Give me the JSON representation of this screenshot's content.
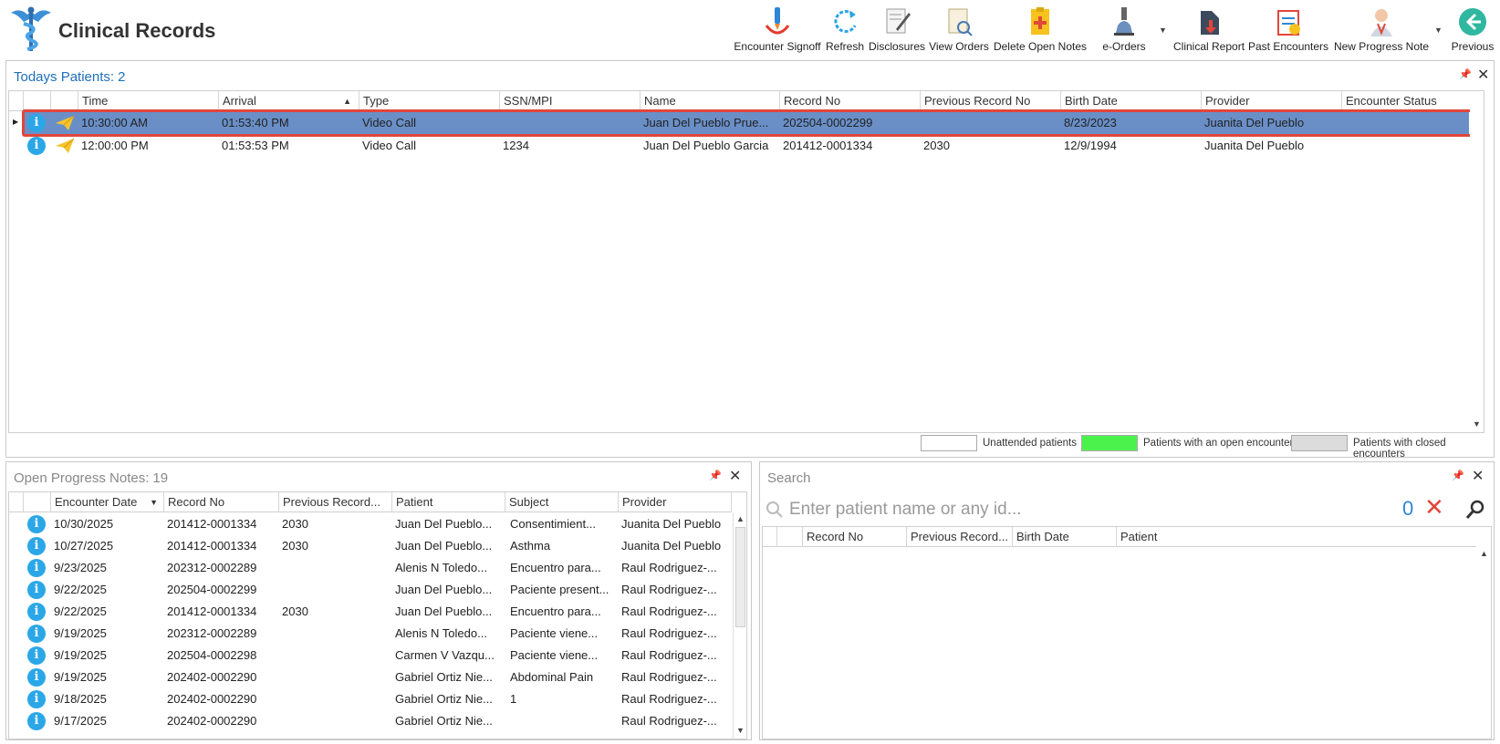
{
  "app": {
    "title": "Clinical Records"
  },
  "toolbar": [
    {
      "label": "Encounter Signoff",
      "icon": "encounter-signoff-icon"
    },
    {
      "label": "Refresh",
      "icon": "refresh-icon"
    },
    {
      "label": "Disclosures",
      "icon": "disclosures-icon"
    },
    {
      "label": "View Orders",
      "icon": "view-orders-icon"
    },
    {
      "label": "Delete Open Notes",
      "icon": "delete-open-notes-icon"
    },
    {
      "label": "e-Orders",
      "icon": "e-orders-icon"
    },
    {
      "label": "Clinical Report",
      "icon": "clinical-report-icon"
    },
    {
      "label": "Past Encounters",
      "icon": "past-encounters-icon"
    },
    {
      "label": "New Progress Note",
      "icon": "new-progress-note-icon"
    },
    {
      "label": "Previous",
      "icon": "previous-arrow-icon"
    }
  ],
  "todays": {
    "title": "Todays Patients:",
    "count": "2",
    "columns": [
      "Time",
      "Arrival",
      "Type",
      "SSN/MPI",
      "Name",
      "Record No",
      "Previous Record No",
      "Birth Date",
      "Provider",
      "Encounter Status"
    ],
    "rows": [
      [
        "10:30:00 AM",
        "01:53:40 PM",
        "Video Call",
        "",
        "Juan Del Pueblo Prue...",
        "202504-0002299",
        "",
        "8/23/2023",
        "Juanita Del Pueblo",
        ""
      ],
      [
        "12:00:00 PM",
        "01:53:53 PM",
        "Video Call",
        "1234",
        "Juan Del Pueblo Garcia",
        "201412-0001334",
        "2030",
        "12/9/1994",
        "Juanita Del Pueblo",
        ""
      ]
    ],
    "legend": {
      "unattended": "Unattended patients",
      "open": "Patients with an open encounter",
      "closed": "Patients with closed encounters",
      "open_color": "#4cf24c",
      "closed_color": "#dcdcdc"
    }
  },
  "notes": {
    "title": "Open Progress Notes:",
    "count": "19",
    "columns": [
      "Encounter Date",
      "Record No",
      "Previous Record...",
      "Patient",
      "Subject",
      "Provider"
    ],
    "rows": [
      [
        "10/30/2025",
        "201412-0001334",
        "2030",
        "Juan Del Pueblo...",
        "Consentimient...",
        "Juanita Del Pueblo"
      ],
      [
        "10/27/2025",
        "201412-0001334",
        "2030",
        "Juan Del Pueblo...",
        "Asthma",
        "Juanita Del Pueblo"
      ],
      [
        "9/23/2025",
        "202312-0002289",
        "",
        "Alenis N Toledo...",
        "Encuentro para...",
        "Raul Rodriguez-..."
      ],
      [
        "9/22/2025",
        "202504-0002299",
        "",
        "Juan Del Pueblo...",
        "Paciente present...",
        "Raul Rodriguez-..."
      ],
      [
        "9/22/2025",
        "201412-0001334",
        "2030",
        "Juan Del Pueblo...",
        "Encuentro para...",
        "Raul Rodriguez-..."
      ],
      [
        "9/19/2025",
        "202312-0002289",
        "",
        "Alenis N Toledo...",
        "Paciente viene...",
        "Raul Rodriguez-..."
      ],
      [
        "9/19/2025",
        "202504-0002298",
        "",
        "Carmen V Vazqu...",
        "Paciente viene...",
        "Raul Rodriguez-..."
      ],
      [
        "9/19/2025",
        "202402-0002290",
        "",
        "Gabriel Ortiz Nie...",
        "Abdominal Pain",
        "Raul Rodriguez-..."
      ],
      [
        "9/18/2025",
        "202402-0002290",
        "",
        "Gabriel Ortiz Nie...",
        "1",
        "Raul Rodriguez-..."
      ],
      [
        "9/17/2025",
        "202402-0002290",
        "",
        "Gabriel Ortiz Nie...",
        "",
        "Raul Rodriguez-..."
      ]
    ]
  },
  "search": {
    "title": "Search",
    "placeholder": "Enter patient name or any id...",
    "count": "0",
    "columns": [
      "Record No",
      "Previous Record...",
      "Birth Date",
      "Patient"
    ]
  },
  "colors": {
    "accent": "#1f6fb8",
    "selected_row": "#6a8fc7",
    "selection_outline": "#e2463b",
    "info_icon": "#2ba7e8"
  }
}
